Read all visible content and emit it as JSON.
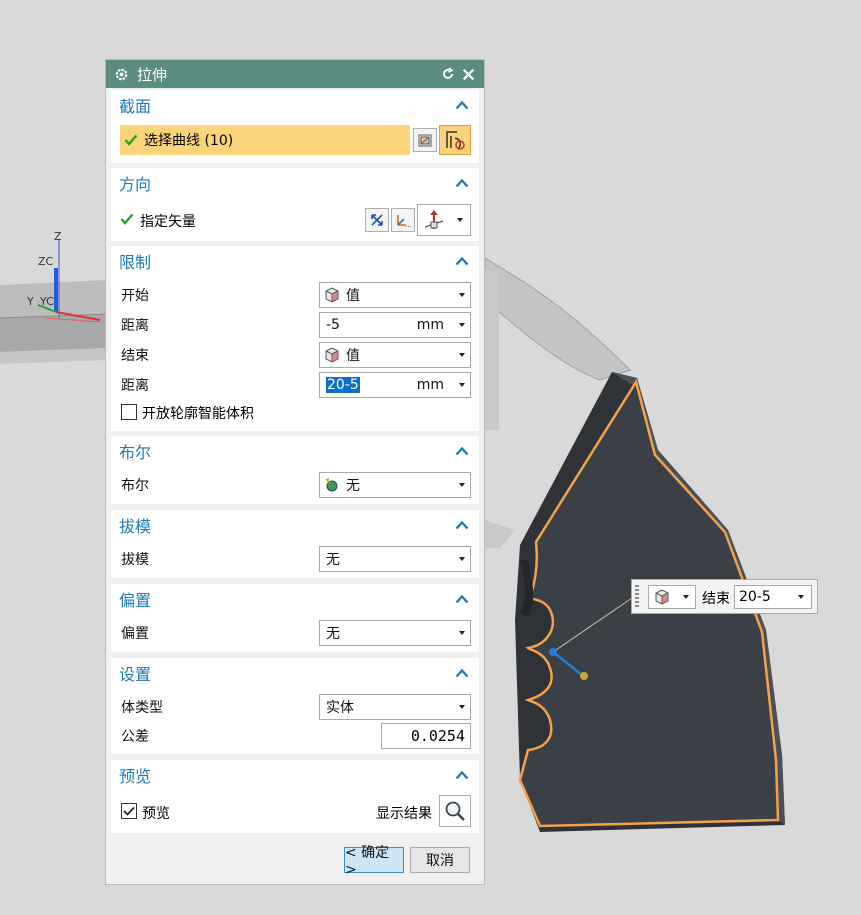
{
  "dialog": {
    "title": "拉伸",
    "sections": {
      "section": {
        "title": "截面",
        "select_curve_label": "选择曲线 (10)"
      },
      "direction": {
        "title": "方向",
        "vector_label": "指定矢量"
      },
      "limits": {
        "title": "限制",
        "start_label": "开始",
        "start_value": "值",
        "start_distance_label": "距离",
        "start_distance_value": "-5",
        "start_distance_unit": "mm",
        "end_label": "结束",
        "end_value": "值",
        "end_distance_label": "距离",
        "end_distance_value": "20-5",
        "end_distance_unit": "mm",
        "open_profile_label": "开放轮廓智能体积"
      },
      "boolean": {
        "title": "布尔",
        "label": "布尔",
        "value": "无"
      },
      "draft": {
        "title": "拔模",
        "label": "拔模",
        "value": "无"
      },
      "offset": {
        "title": "偏置",
        "label": "偏置",
        "value": "无"
      },
      "settings": {
        "title": "设置",
        "body_type_label": "体类型",
        "body_type_value": "实体",
        "tolerance_label": "公差",
        "tolerance_value": "0.0254"
      },
      "preview": {
        "title": "预览",
        "preview_label": "预览",
        "show_result_label": "显示结果"
      }
    },
    "ok_label": "< 确定 >",
    "cancel_label": "取消"
  },
  "float_toolbar": {
    "end_label": "结束",
    "end_value": "20-5"
  },
  "axes": {
    "z": "Z",
    "zc": "ZC",
    "yc": "YC",
    "y": "Y"
  },
  "colors": {
    "title_bar": "#5b8c82",
    "section_title": "#1f7ab5",
    "selected_row": "#fbd37a",
    "part_body": "#3a3f45",
    "edge_highlight": "#f5a04a"
  }
}
